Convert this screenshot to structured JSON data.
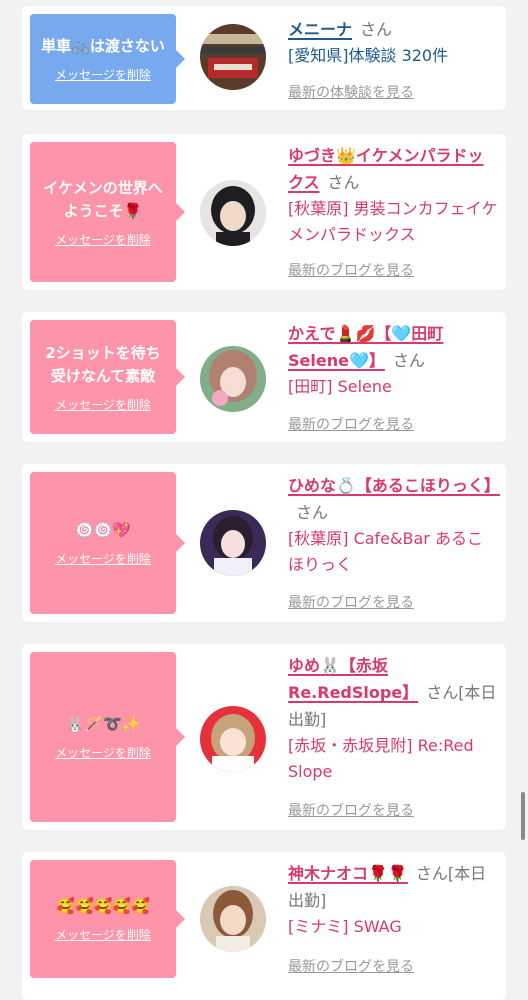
{
  "cards": [
    {
      "bubble": {
        "message": "単車🚲は渡さない",
        "delete_label": "メッセージを削除",
        "color": "#78a9ee"
      },
      "name": "メニーナ",
      "honorific": "さん",
      "detail": "[愛知県]体験談 320件",
      "link": "最新の体験談を見る",
      "text_color": "#1f5a8f"
    },
    {
      "bubble": {
        "message": "イケメンの世界へ\nようこそ🌹",
        "delete_label": "メッセージを削除",
        "color": "#fd94a9"
      },
      "name": "ゆづき👑イケメンパラドックス",
      "honorific": "さん",
      "detail": "[秋葉原] 男装コンカフェイケメンパラドックス",
      "link": "最新のブログを見る",
      "text_color": "#d93a6b"
    },
    {
      "bubble": {
        "message": "2ショットを待ち\n受けなんて素敵",
        "delete_label": "メッセージを削除",
        "color": "#fd94a9"
      },
      "name": "かえで💄💋【🩵田町Selene🩵】",
      "honorific": "さん",
      "detail": "[田町] Selene",
      "link": "最新のブログを見る",
      "text_color": "#d93a6b"
    },
    {
      "bubble": {
        "message": "🍥🍥💖",
        "delete_label": "メッセージを削除",
        "color": "#fd94a9"
      },
      "name": "ひめな💍【あるこほりっく】",
      "honorific": "さん",
      "detail": "[秋葉原] Cafe&Bar あるこほりっく",
      "link": "最新のブログを見る",
      "text_color": "#d93a6b"
    },
    {
      "bubble": {
        "message": "🐰🪄➰✨",
        "delete_label": "メッセージを削除",
        "color": "#fd94a9"
      },
      "name": "ゆめ🐰【赤坂Re.RedSlope】",
      "honorific": "さん[本日出勤]",
      "detail": "[赤坂・赤坂見附] Re:Red Slope",
      "link": "最新のブログを見る",
      "text_color": "#d93a6b"
    },
    {
      "bubble": {
        "message": "🥰🥰🥰🥰🥰",
        "delete_label": "メッセージを削除",
        "color": "#fd94a9"
      },
      "name": "神木ナオコ🌹🌹",
      "honorific": "さん[本日出勤]",
      "detail": "[ミナミ] SWAG",
      "link": "最新のブログを見る",
      "text_color": "#d93a6b"
    }
  ]
}
